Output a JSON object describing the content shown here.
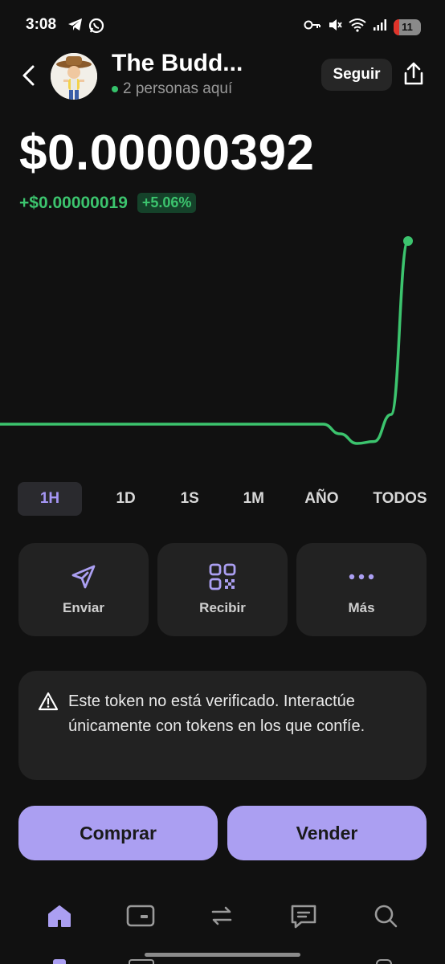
{
  "status_bar": {
    "time": "3:08",
    "battery_level": "11",
    "icons": [
      "telegram-icon",
      "whatsapp-icon",
      "key-icon",
      "mute-icon",
      "wifi-icon",
      "signal-icon"
    ]
  },
  "header": {
    "token_name": "The Budd...",
    "presence": "2 personas aquí",
    "follow_label": "Seguir"
  },
  "price": {
    "value": "$0.00000392",
    "change_abs": "+$0.00000019",
    "change_pct": "+5.06%"
  },
  "chart_data": {
    "type": "line",
    "series": [
      {
        "values": [
          3.73e-06,
          3.73e-06,
          3.73e-06,
          3.73e-06,
          3.73e-06,
          3.73e-06,
          3.73e-06,
          3.73e-06,
          3.73e-06,
          3.73e-06,
          3.73e-06,
          3.73e-06,
          3.73e-06,
          3.73e-06,
          3.73e-06,
          3.73e-06,
          3.73e-06,
          3.73e-06,
          3.73e-06,
          3.73e-06,
          3.72e-06,
          3.71e-06,
          3.712e-06,
          3.74e-06,
          3.92e-06
        ]
      }
    ],
    "color": "#3cc46e"
  },
  "ranges": {
    "active": "1H",
    "items": [
      "1H",
      "1D",
      "1S",
      "1M",
      "AÑO",
      "TODOS"
    ]
  },
  "actions": [
    {
      "label": "Enviar",
      "icon": "send-icon"
    },
    {
      "label": "Recibir",
      "icon": "qr-code-icon"
    },
    {
      "label": "Más",
      "icon": "more-dots-icon"
    }
  ],
  "warning": {
    "text": "Este token no está verificado. Interactúe únicamente con tokens en los que confíe.",
    "icon": "warning-triangle-icon"
  },
  "trade": {
    "buy_label": "Comprar",
    "sell_label": "Vender"
  },
  "nav": {
    "items": [
      "home-icon",
      "wallet-icon",
      "swap-icon",
      "chat-icon",
      "search-icon"
    ],
    "active": "home-icon"
  },
  "colors": {
    "accent": "#ab9ff2",
    "positive": "#3cc46e",
    "background": "#111111",
    "card": "#222222"
  }
}
